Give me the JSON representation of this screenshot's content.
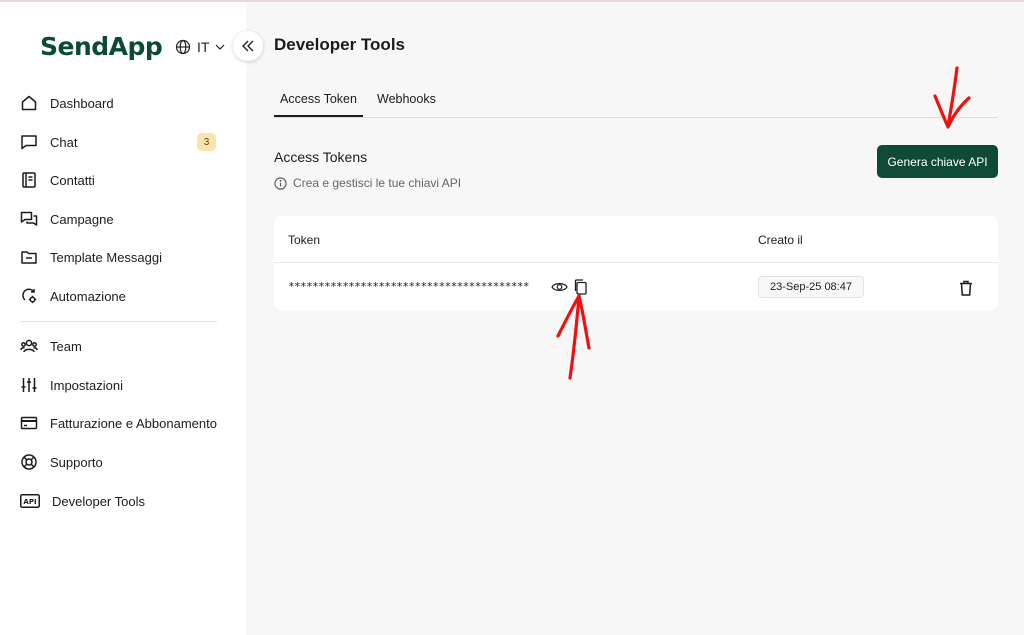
{
  "brand": {
    "name": "SendApp"
  },
  "language": {
    "code": "IT"
  },
  "sidebar": {
    "items": [
      {
        "label": "Dashboard",
        "icon": "home-icon"
      },
      {
        "label": "Chat",
        "icon": "chat-icon",
        "badge": "3"
      },
      {
        "label": "Contatti",
        "icon": "contacts-icon"
      },
      {
        "label": "Campagne",
        "icon": "campaign-icon"
      },
      {
        "label": "Template Messaggi",
        "icon": "folder-icon"
      },
      {
        "label": "Automazione",
        "icon": "automation-icon"
      },
      {
        "label": "Team",
        "icon": "team-icon"
      },
      {
        "label": "Impostazioni",
        "icon": "sliders-icon"
      },
      {
        "label": "Fatturazione e Abbonamento",
        "icon": "credit-card-icon"
      },
      {
        "label": "Supporto",
        "icon": "lifebuoy-icon"
      },
      {
        "label": "Developer Tools",
        "icon": "api-icon",
        "icon_text": "API"
      }
    ]
  },
  "main": {
    "title": "Developer Tools",
    "tabs": [
      {
        "label": "Access Token",
        "active": true
      },
      {
        "label": "Webhooks",
        "active": false
      }
    ],
    "section": {
      "title": "Access Tokens",
      "subtitle": "Crea e gestisci le tue chiavi API"
    },
    "generate_button": "Genera chiave API",
    "table": {
      "headers": {
        "token": "Token",
        "created": "Creato il"
      },
      "rows": [
        {
          "token": "****************************************",
          "created": "23-Sep-25 08:47"
        }
      ]
    }
  },
  "colors": {
    "brand_green": "#0f4a37",
    "badge_bg": "#fbe3ad",
    "annotation_red": "#ee1111"
  }
}
